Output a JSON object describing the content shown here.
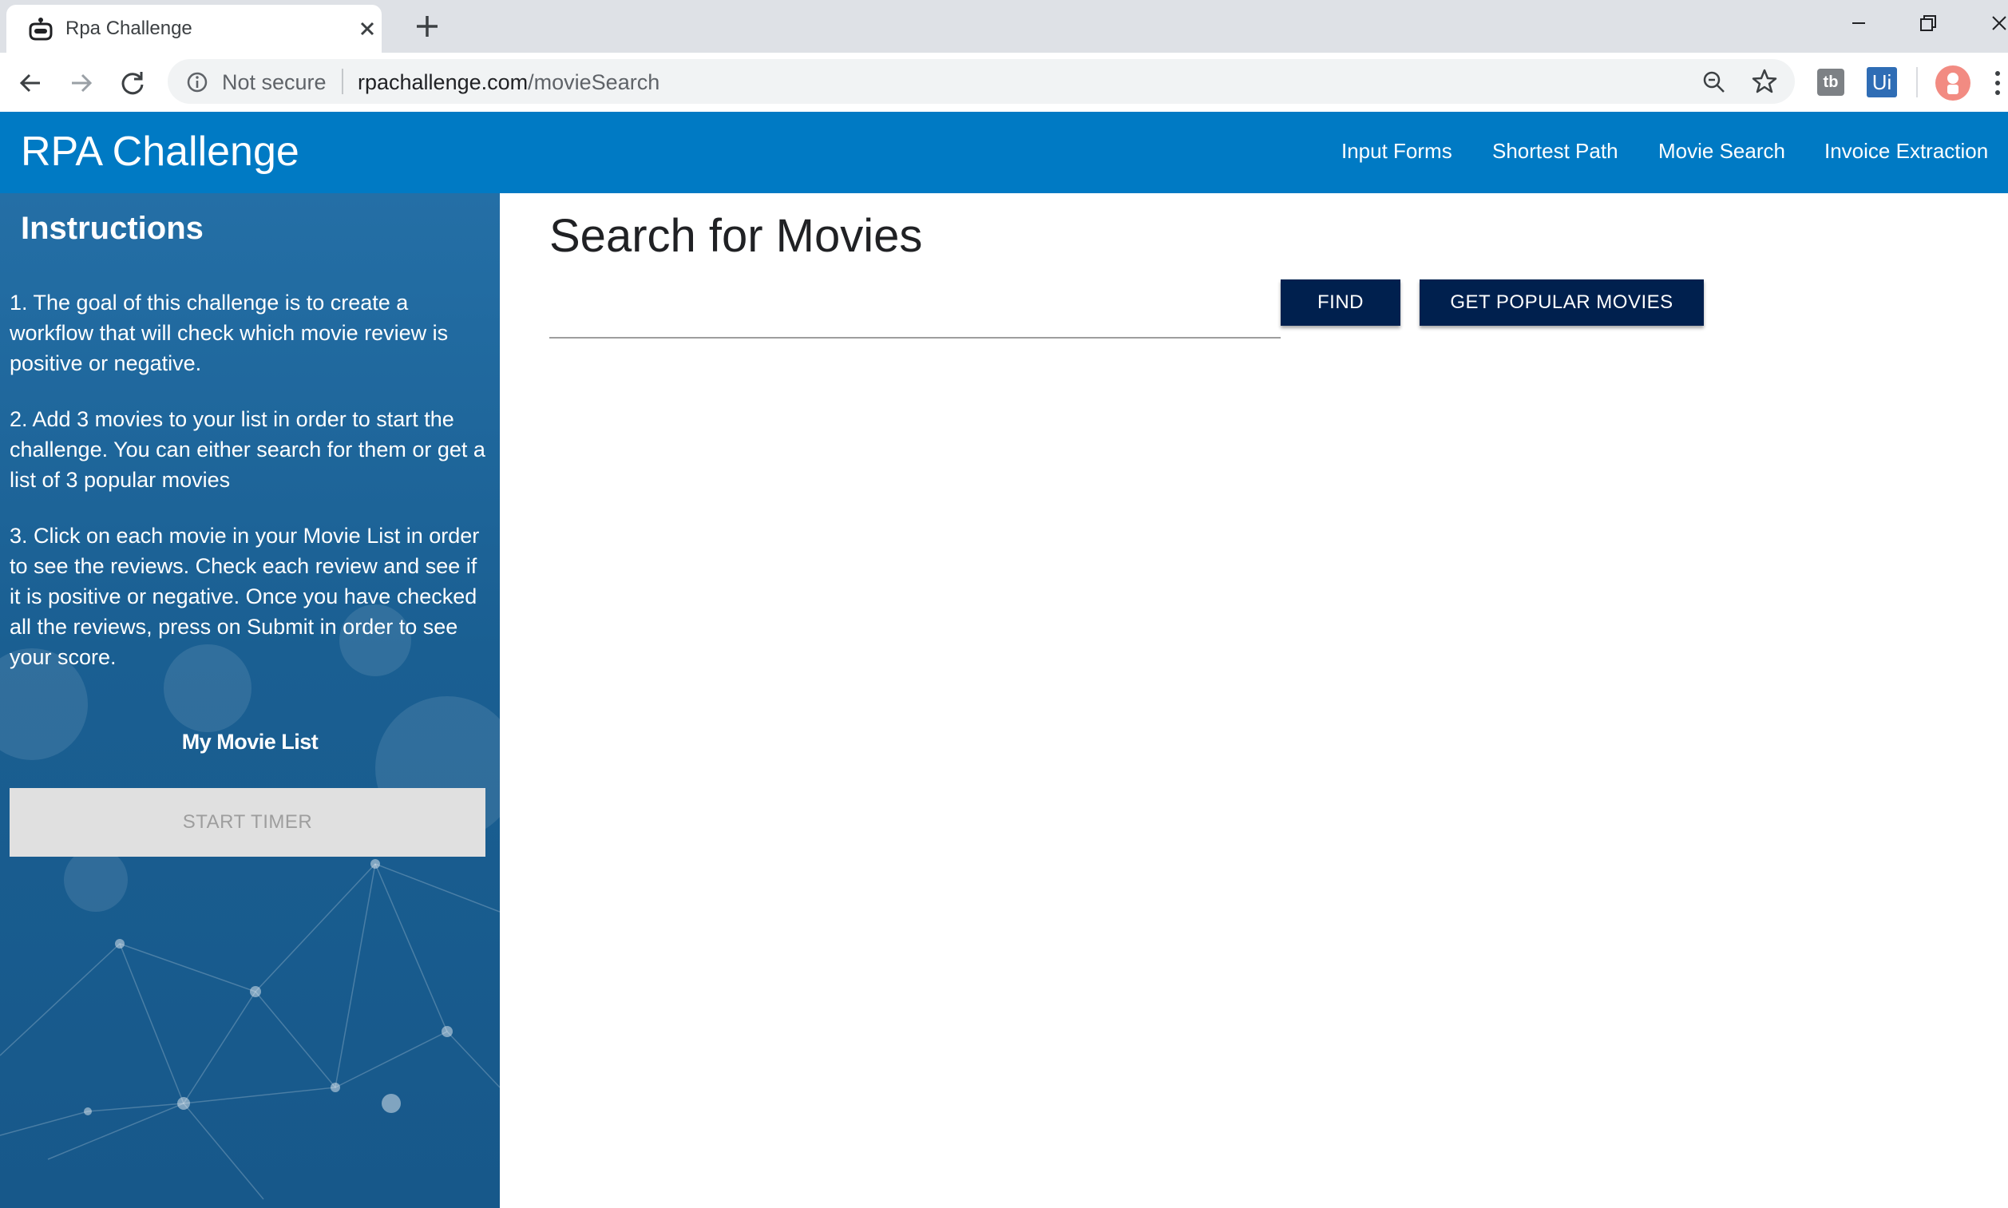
{
  "browser": {
    "tab_title": "Rpa Challenge",
    "security_label": "Not secure",
    "url_host": "rpachallenge.com",
    "url_path": "/movieSearch",
    "extensions": [
      "tb",
      "Ui"
    ]
  },
  "header": {
    "brand": "RPA Challenge",
    "nav": [
      "Input Forms",
      "Shortest Path",
      "Movie Search",
      "Invoice Extraction"
    ]
  },
  "sidebar": {
    "title": "Instructions",
    "steps": [
      "1. The goal of this challenge is to create a workflow that will check which movie review is positive or negative.",
      "2. Add 3 movies to your list in order to start the challenge. You can either search for them or get a list of 3 popular movies",
      "3. Click on each movie in your Movie List in order to see the reviews. Check each review and see if it is positive or negative. Once you have checked all the reviews, press on Submit in order to see your score."
    ],
    "movie_list_title": "My Movie List",
    "start_timer_label": "START TIMER"
  },
  "main": {
    "title": "Search for Movies",
    "search_value": "",
    "find_label": "FIND",
    "popular_label": "GET POPULAR MOVIES"
  },
  "colors": {
    "header_bg": "#007ac4",
    "button_bg": "#00204e",
    "sidebar_bg": "#1a5f92"
  }
}
